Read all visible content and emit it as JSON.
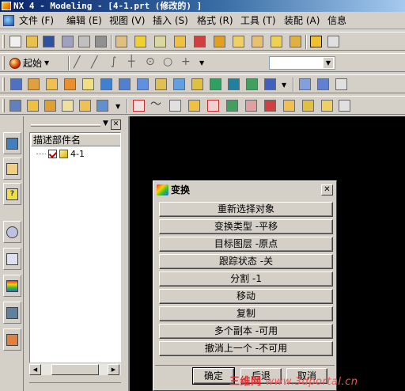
{
  "window": {
    "title": "NX 4 - Modeling - [4-1.prt (修改的) ]"
  },
  "menubar": {
    "items": [
      "文件 (F)",
      "编辑 (E)",
      "视图 (V)",
      "插入 (S)",
      "格式 (R)",
      "工具 (T)",
      "装配 (A)",
      "信息"
    ]
  },
  "toolbar": {
    "start_label": "起始",
    "start_icon": "start-globe-icon"
  },
  "navigator": {
    "column_header": "描述部件名",
    "tree_items": [
      {
        "name": "4-1",
        "checked": true
      }
    ]
  },
  "dialog": {
    "title": "变换",
    "options": [
      "重新选择对象",
      "变换类型 -平移",
      "目标图层 -原点",
      "跟踪状态 -关",
      "分割 -1",
      "移动",
      "复制",
      "多个副本 -可用",
      "撤消上一个 -不可用"
    ],
    "ok_label": "确定",
    "back_label": "后退",
    "cancel_label": "取消"
  },
  "watermark": {
    "text1": "三维网",
    "text2": "www.3dportal.cn"
  },
  "colors": {
    "title_bar_start": "#0a246a",
    "graphics_background": "#000000",
    "chrome": "#d4d0c8",
    "watermark": "#e03030"
  }
}
